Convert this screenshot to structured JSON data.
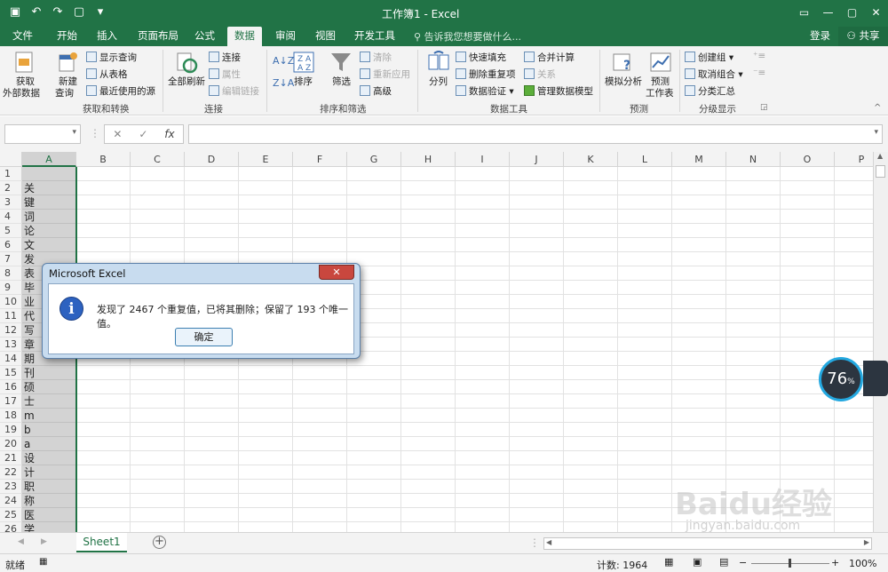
{
  "app": {
    "window_title": "工作簿1 - Excel",
    "accent_color": "#217346",
    "qat_icons": [
      "save-icon",
      "undo-icon",
      "redo-icon",
      "touch-mode-icon",
      "customize-icon"
    ],
    "controls": [
      "ribbon-display-icon",
      "minimize-icon",
      "restore-icon",
      "close-icon"
    ]
  },
  "tabs": [
    "文件",
    "开始",
    "插入",
    "页面布局",
    "公式",
    "数据",
    "审阅",
    "视图",
    "开发工具"
  ],
  "active_tab": "数据",
  "tell_me": "告诉我您想要做什么...",
  "account": {
    "login": "登录",
    "share": "共享"
  },
  "ribbon": {
    "get_external": "获取",
    "get_external2": "外部数据",
    "new_query": "新建",
    "new_query2": "查询",
    "show_queries": "显示查询",
    "from_table": "从表格",
    "recent_sources": "最近使用的源",
    "group_get_transform": "获取和转换",
    "refresh_all": "全部刷新",
    "connections": "连接",
    "properties": "属性",
    "edit_links": "编辑链接",
    "group_connections": "连接",
    "sort": "排序",
    "filter": "筛选",
    "clear": "清除",
    "reapply": "重新应用",
    "advanced": "高级",
    "group_sort_filter": "排序和筛选",
    "text_to_columns": "分列",
    "flash_fill": "快速填充",
    "remove_duplicates": "删除重复项",
    "data_validation": "数据验证",
    "consolidate": "合并计算",
    "relationships": "关系",
    "manage_data_model": "管理数据模型",
    "group_data_tools": "数据工具",
    "what_if": "模拟分析",
    "forecast_sheet": "预测",
    "forecast_sheet2": "工作表",
    "group_forecast": "预测",
    "group": "创建组",
    "ungroup": "取消组合",
    "subtotal": "分类汇总",
    "group_outline": "分级显示"
  },
  "formula_bar": {
    "name_box": "",
    "formula": "",
    "cancel": "✕",
    "enter": "✓",
    "fx": "fx"
  },
  "columns": [
    "A",
    "B",
    "C",
    "D",
    "E",
    "F",
    "G",
    "H",
    "I",
    "J",
    "K",
    "L",
    "M",
    "N",
    "O",
    "P"
  ],
  "rows": [
    "1",
    "2",
    "3",
    "4",
    "5",
    "6",
    "7",
    "8",
    "9",
    "10",
    "11",
    "12",
    "13",
    "14",
    "15",
    "16",
    "17",
    "18",
    "19",
    "20",
    "21",
    "22",
    "23",
    "24",
    "25",
    "26"
  ],
  "column_a": [
    "",
    "关",
    "键",
    "词",
    "论",
    "文",
    "发",
    "表",
    "毕",
    "业",
    "代",
    "写",
    "章",
    "期",
    "刊",
    "硕",
    "士",
    "m",
    "b",
    "a",
    "设",
    "计",
    "职",
    "称",
    "医",
    "学"
  ],
  "sheet_tab": "Sheet1",
  "status": {
    "ready": "就绪",
    "count": "计数: 1964",
    "zoom": "100%"
  },
  "dialog": {
    "title": "Microsoft Excel",
    "close": "✕",
    "message": "发现了 2467 个重复值，已将其删除；保留了 193 个唯一值。",
    "ok": "确定"
  },
  "overlay": {
    "gauge_value": "76",
    "gauge_unit": "%"
  },
  "watermark": {
    "brand": "Baidu经验",
    "url": "jingyan.baidu.com"
  }
}
